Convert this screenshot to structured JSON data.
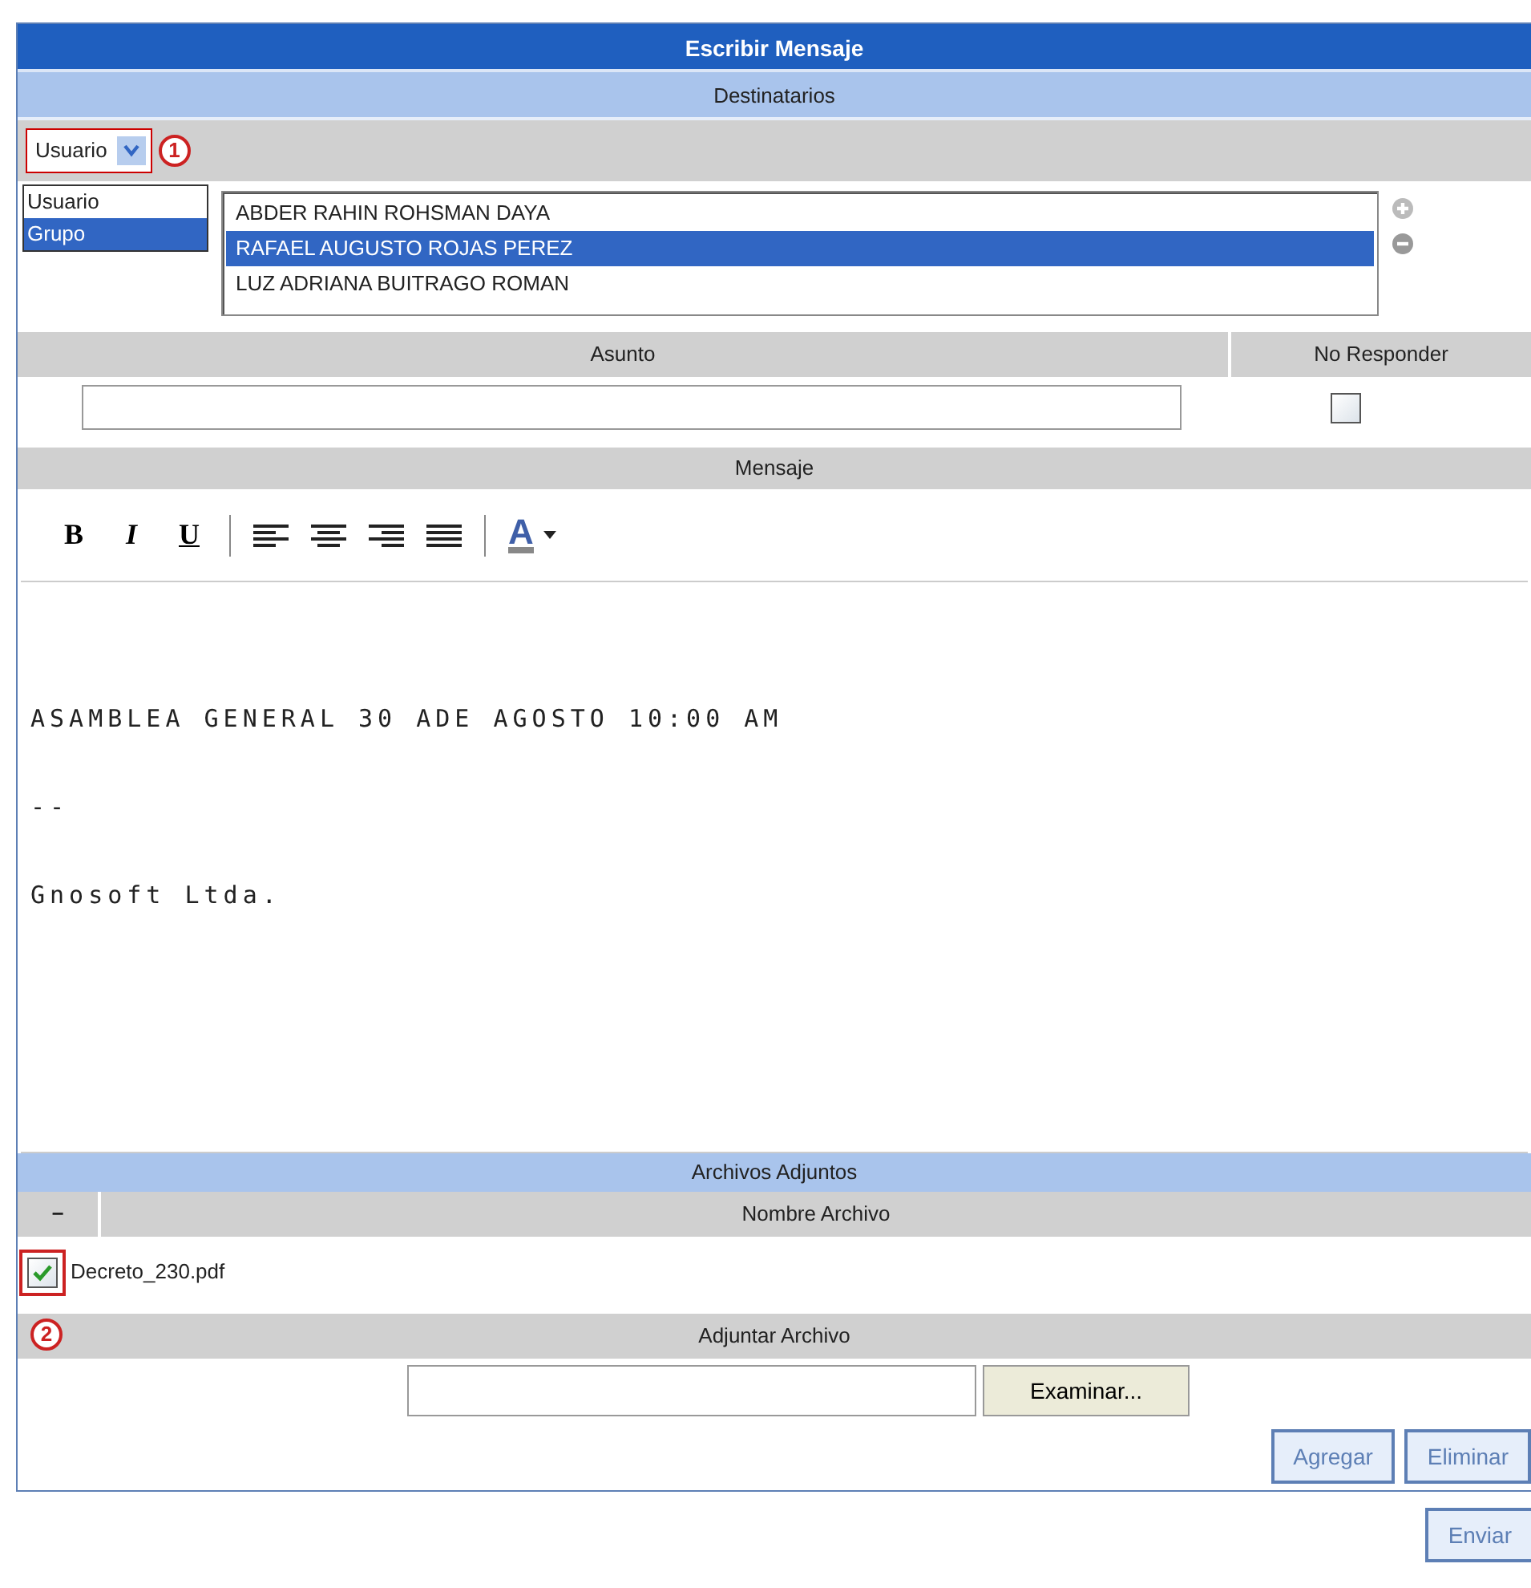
{
  "title": "Escribir Mensaje",
  "recipients": {
    "header": "Destinatarios",
    "type_select": {
      "value": "Usuario",
      "expanded": true,
      "marker": "1",
      "options": [
        {
          "label": "Usuario",
          "highlighted": false
        },
        {
          "label": "Grupo",
          "highlighted": true
        }
      ]
    },
    "list": [
      {
        "name": "ABDER RAHIN ROHSMAN DAYA",
        "selected": false
      },
      {
        "name": "RAFAEL AUGUSTO ROJAS PEREZ",
        "selected": true
      },
      {
        "name": "LUZ ADRIANA BUITRAGO ROMAN",
        "selected": false
      }
    ]
  },
  "subject": {
    "header": "Asunto"
  },
  "no_reply": {
    "header": "No Responder",
    "checked": false
  },
  "message": {
    "header": "Mensaje",
    "toolbar": [
      {
        "kind": "bold",
        "label": "B"
      },
      {
        "kind": "italic",
        "label": "I"
      },
      {
        "kind": "underline",
        "label": "U"
      },
      {
        "kind": "separator"
      },
      {
        "kind": "align-left"
      },
      {
        "kind": "align-center"
      },
      {
        "kind": "align-right"
      },
      {
        "kind": "justify"
      },
      {
        "kind": "separator"
      },
      {
        "kind": "color",
        "label": "A"
      }
    ],
    "body": [
      "ASAMBLEA GENERAL 30 ADE AGOSTO 10:00 AM",
      "--",
      "Gnosoft Ltda."
    ]
  },
  "attachments": {
    "header": "Archivos Adjuntos",
    "toggle": "−",
    "column": "Nombre Archivo",
    "files": [
      {
        "name": "Decreto_230.pdf",
        "checked": true,
        "marker": "2"
      }
    ],
    "add_header": "Adjuntar Archivo",
    "browse_button": "Examinar...",
    "buttons": [
      "Agregar",
      "Eliminar"
    ]
  },
  "send_button": "Enviar"
}
